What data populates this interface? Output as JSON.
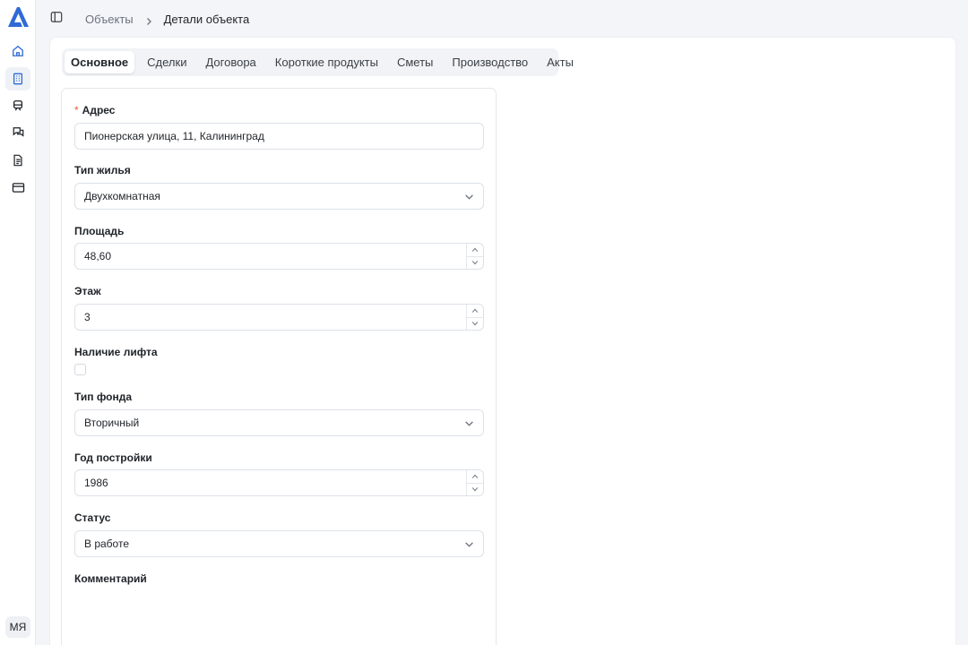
{
  "sidebar": {
    "avatar_initials": "МЯ",
    "accent_color": "#2f6bd6",
    "icons": [
      "home-icon",
      "building-icon",
      "train-icon",
      "chat-icon",
      "document-icon",
      "card-icon"
    ]
  },
  "breadcrumb": {
    "parent": "Объекты",
    "current": "Детали объекта"
  },
  "tabs": [
    {
      "label": "Основное",
      "active": true
    },
    {
      "label": "Сделки"
    },
    {
      "label": "Договора"
    },
    {
      "label": "Короткие продукты"
    },
    {
      "label": "Сметы"
    },
    {
      "label": "Производство"
    },
    {
      "label": "Акты"
    }
  ],
  "form": {
    "address": {
      "label": "Адрес",
      "required_mark": "*",
      "value": "Пионерская улица, 11, Калининград"
    },
    "housing_type": {
      "label": "Тип жилья",
      "value": "Двухкомнатная"
    },
    "area": {
      "label": "Площадь",
      "value": "48,60"
    },
    "floor": {
      "label": "Этаж",
      "value": "3"
    },
    "elevator": {
      "label": "Наличие лифта",
      "checked": false
    },
    "fund_type": {
      "label": "Тип фонда",
      "value": "Вторичный"
    },
    "build_year": {
      "label": "Год постройки",
      "value": "1986"
    },
    "status": {
      "label": "Статус",
      "value": "В работе"
    },
    "comment": {
      "label": "Комментарий"
    }
  }
}
